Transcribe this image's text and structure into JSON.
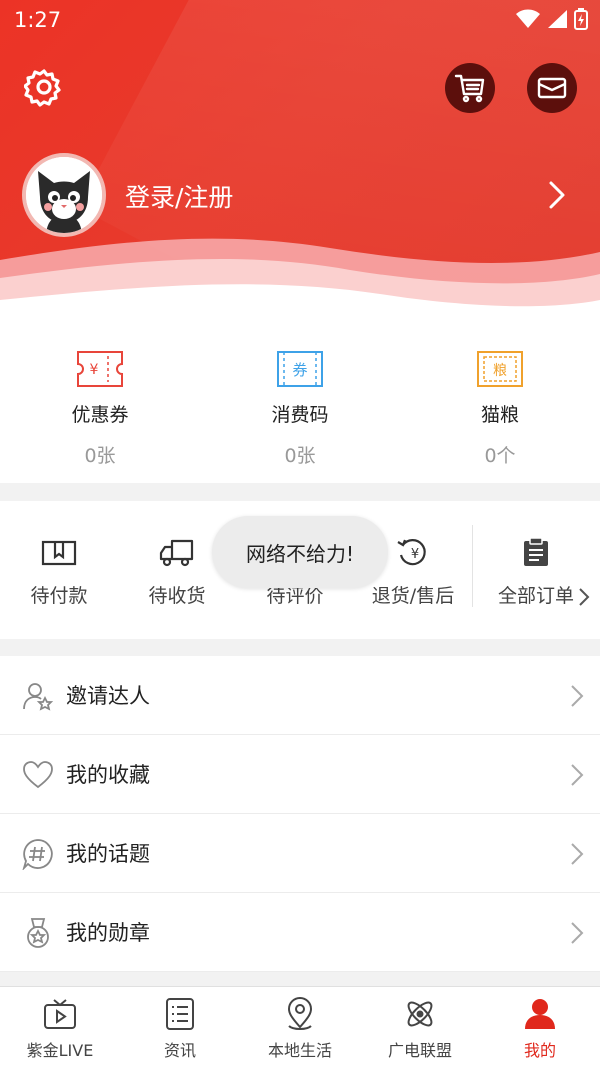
{
  "status_bar": {
    "time": "1:27"
  },
  "header": {
    "login_label": "登录/注册"
  },
  "assets": [
    {
      "label": "优惠券",
      "value": "0张",
      "icon": "coupon-yuan-icon",
      "color": "#e8453a"
    },
    {
      "label": "消费码",
      "value": "0张",
      "icon": "voucher-icon",
      "color": "#3ea2e8"
    },
    {
      "label": "猫粮",
      "value": "0个",
      "icon": "cat-food-icon",
      "color": "#f0a12c"
    }
  ],
  "orders": [
    {
      "label": "待付款",
      "icon": "wallet-icon"
    },
    {
      "label": "待收货",
      "icon": "truck-icon"
    },
    {
      "label": "待评价",
      "icon": "comment-icon"
    },
    {
      "label": "退货/售后",
      "icon": "refund-icon"
    },
    {
      "label": "全部订单",
      "icon": "clipboard-icon"
    }
  ],
  "toast": "网络不给力!",
  "menu": [
    {
      "label": "邀请达人",
      "icon": "invite-user-icon"
    },
    {
      "label": "我的收藏",
      "icon": "heart-icon"
    },
    {
      "label": "我的话题",
      "icon": "hashtag-icon"
    },
    {
      "label": "我的勋章",
      "icon": "medal-icon"
    }
  ],
  "bottom_nav": [
    {
      "label": "紫金LIVE",
      "icon": "tv-icon"
    },
    {
      "label": "资讯",
      "icon": "news-icon"
    },
    {
      "label": "本地生活",
      "icon": "location-icon"
    },
    {
      "label": "广电联盟",
      "icon": "atom-icon"
    },
    {
      "label": "我的",
      "icon": "user-icon",
      "active": true
    }
  ],
  "colors": {
    "brand_red": "#e73a2c",
    "active_tab": "#e0281c"
  }
}
